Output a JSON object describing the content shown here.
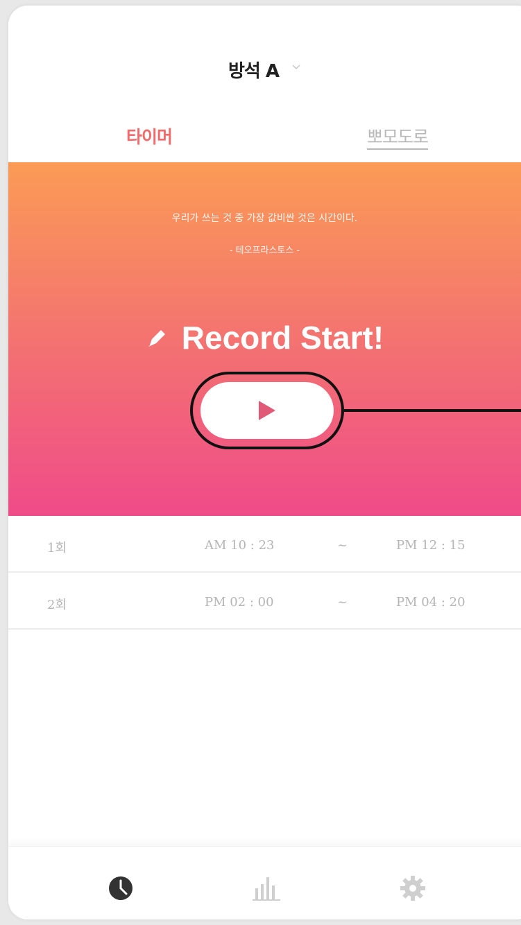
{
  "header": {
    "room_title": "방석 A",
    "tabs": [
      {
        "label": "타이머",
        "active": true
      },
      {
        "label": "뽀모도로",
        "active": false
      }
    ]
  },
  "hero": {
    "quote": "우리가 쓰는 것 중 가장 값비싼 것은 시간이다.",
    "author": "- 테오프라스토스 -",
    "record_title": "Record Start!",
    "play_icon": "play-icon"
  },
  "records": [
    {
      "index": "1회",
      "start": "AM 10 : 23",
      "tilde": "~",
      "end": "PM 12 : 15"
    },
    {
      "index": "2회",
      "start": "PM 02 : 00",
      "tilde": "~",
      "end": "PM 04 : 20"
    }
  ],
  "bottom_nav": {
    "items": [
      "clock-icon",
      "bar-chart-icon",
      "gear-icon"
    ]
  },
  "colors": {
    "accent": "#f26a6a",
    "gradient_top": "#fb9b55",
    "gradient_bottom": "#ef4b89",
    "play_triangle": "#e05a78"
  }
}
